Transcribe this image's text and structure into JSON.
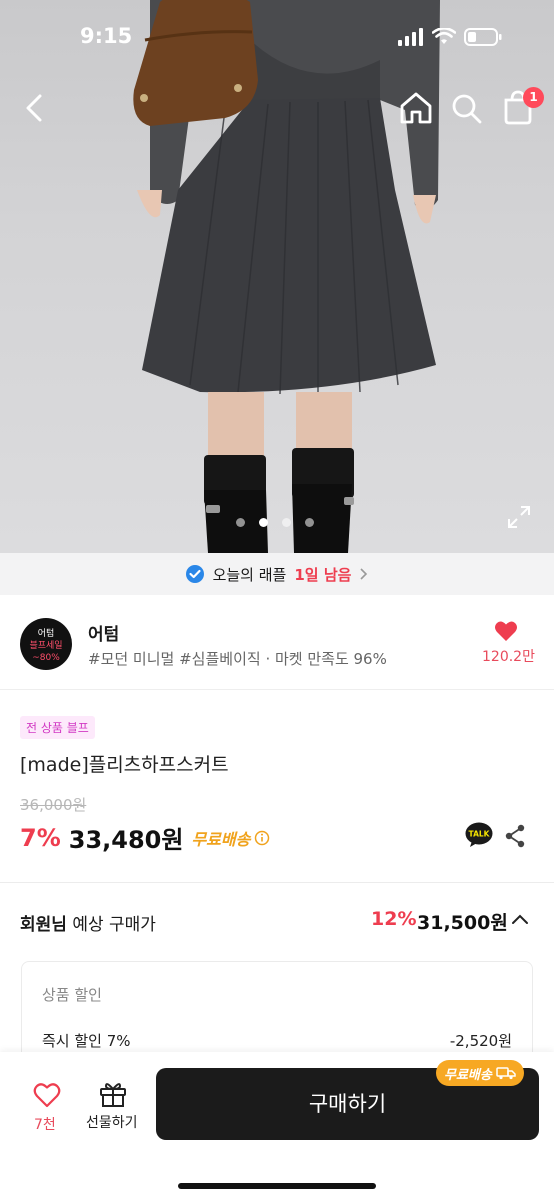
{
  "status_bar": {
    "time": "9:15"
  },
  "header": {
    "cart_count": "1"
  },
  "gallery": {
    "pages": 4,
    "active_index": 1
  },
  "raffle": {
    "text": "오늘의 래플",
    "remaining": "1일 남음"
  },
  "store": {
    "logo_lines": [
      "어텀",
      "블프세일",
      "~80%"
    ],
    "name": "어텀",
    "tags": "#모던 미니멀 #심플베이직 · 마켓 만족도 96%",
    "like_count": "120.2만"
  },
  "product": {
    "badge": "전 상품 블프",
    "title": "[made]플리츠하프스커트",
    "original_price": "36,000원",
    "discount_pct": "7%",
    "price": "33,480원",
    "free_shipping": "무료배송"
  },
  "member_price": {
    "label_bold": "회원님",
    "label_rest": " 예상 구매가",
    "discount_pct": "12%",
    "price": "31,500원"
  },
  "discount_card": {
    "title": "상품 할인",
    "rows": [
      {
        "label": "즉시 할인 7%",
        "value": "-2,520원"
      }
    ]
  },
  "bottom_bar": {
    "like_count": "7천",
    "gift_label": "선물하기",
    "buy_label": "구매하기",
    "ship_chip": "무료배송"
  },
  "colors": {
    "accent_red": "#ee3d4f",
    "free_ship_orange": "#f0a31d",
    "badge_pink": "#d23ac4",
    "buy_button": "#1b1b1b"
  }
}
